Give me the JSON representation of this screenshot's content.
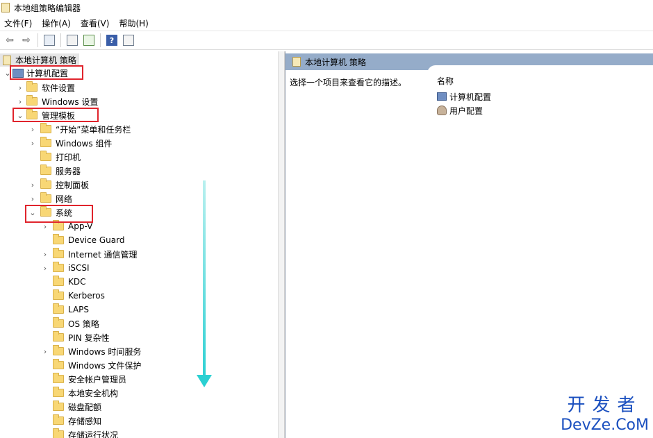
{
  "window": {
    "title": "本地组策略编辑器"
  },
  "menu": [
    "文件(F)",
    "操作(A)",
    "查看(V)",
    "帮助(H)"
  ],
  "toolbar": {
    "buttons": [
      "back-icon",
      "forward-icon",
      "show-hide-tree-icon",
      "properties-icon",
      "export-list-icon",
      "help-icon",
      "extended-view-icon"
    ]
  },
  "tree": {
    "root": "本地计算机 策略",
    "computer_config": "计算机配置",
    "software_settings": "软件设置",
    "windows_settings": "Windows 设置",
    "admin_templates": "管理模板",
    "admin_children": [
      "“开始”菜单和任务栏",
      "Windows 组件",
      "打印机",
      "服务器",
      "控制面板",
      "网络"
    ],
    "system": "系统",
    "system_children": [
      "App-V",
      "Device Guard",
      "Internet 通信管理",
      "iSCSI",
      "KDC",
      "Kerberos",
      "LAPS",
      "OS 策略",
      "PIN 复杂性",
      "Windows 时间服务",
      "Windows 文件保护",
      "安全帐户管理员",
      "本地安全机构",
      "磁盘配额",
      "存储感知",
      "存储运行状况"
    ]
  },
  "right": {
    "header": "本地计算机 策略",
    "description": "选择一个项目来查看它的描述。",
    "column_name": "名称",
    "items": [
      "计算机配置",
      "用户配置"
    ]
  },
  "watermark": {
    "line1": "开发者",
    "line2": "DevZe.CoM"
  },
  "colors": {
    "highlight": "#e0242c",
    "arrow": "#2ad0d2",
    "header": "#95acc9",
    "watermark": "#1a4fbf"
  }
}
